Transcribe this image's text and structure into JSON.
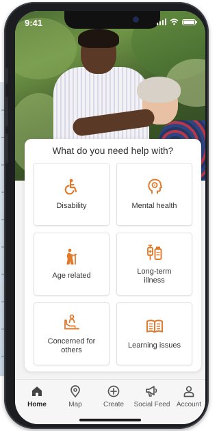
{
  "status_bar": {
    "time": "9:41"
  },
  "help": {
    "title": "What do you need help with?",
    "accent_color": "#e07b2e",
    "options": [
      {
        "label": "Disability",
        "icon": "wheelchair-icon"
      },
      {
        "label": "Mental health",
        "icon": "head-brain-icon"
      },
      {
        "label": "Age related",
        "icon": "elderly-cane-icon"
      },
      {
        "label": "Long-term\nillness",
        "icon": "medicine-iv-icon"
      },
      {
        "label": "Concerned for\nothers",
        "icon": "caregiver-hands-icon"
      },
      {
        "label": "Learning issues",
        "icon": "open-book-icon"
      }
    ]
  },
  "tabbar": {
    "tabs": [
      {
        "label": "Home",
        "icon": "home-icon",
        "active": true
      },
      {
        "label": "Map",
        "icon": "map-pin-icon",
        "active": false
      },
      {
        "label": "Create",
        "icon": "plus-circle-icon",
        "active": false
      },
      {
        "label": "Social Feed",
        "icon": "megaphone-icon",
        "active": false
      },
      {
        "label": "Account",
        "icon": "account-icon",
        "active": false
      }
    ]
  }
}
